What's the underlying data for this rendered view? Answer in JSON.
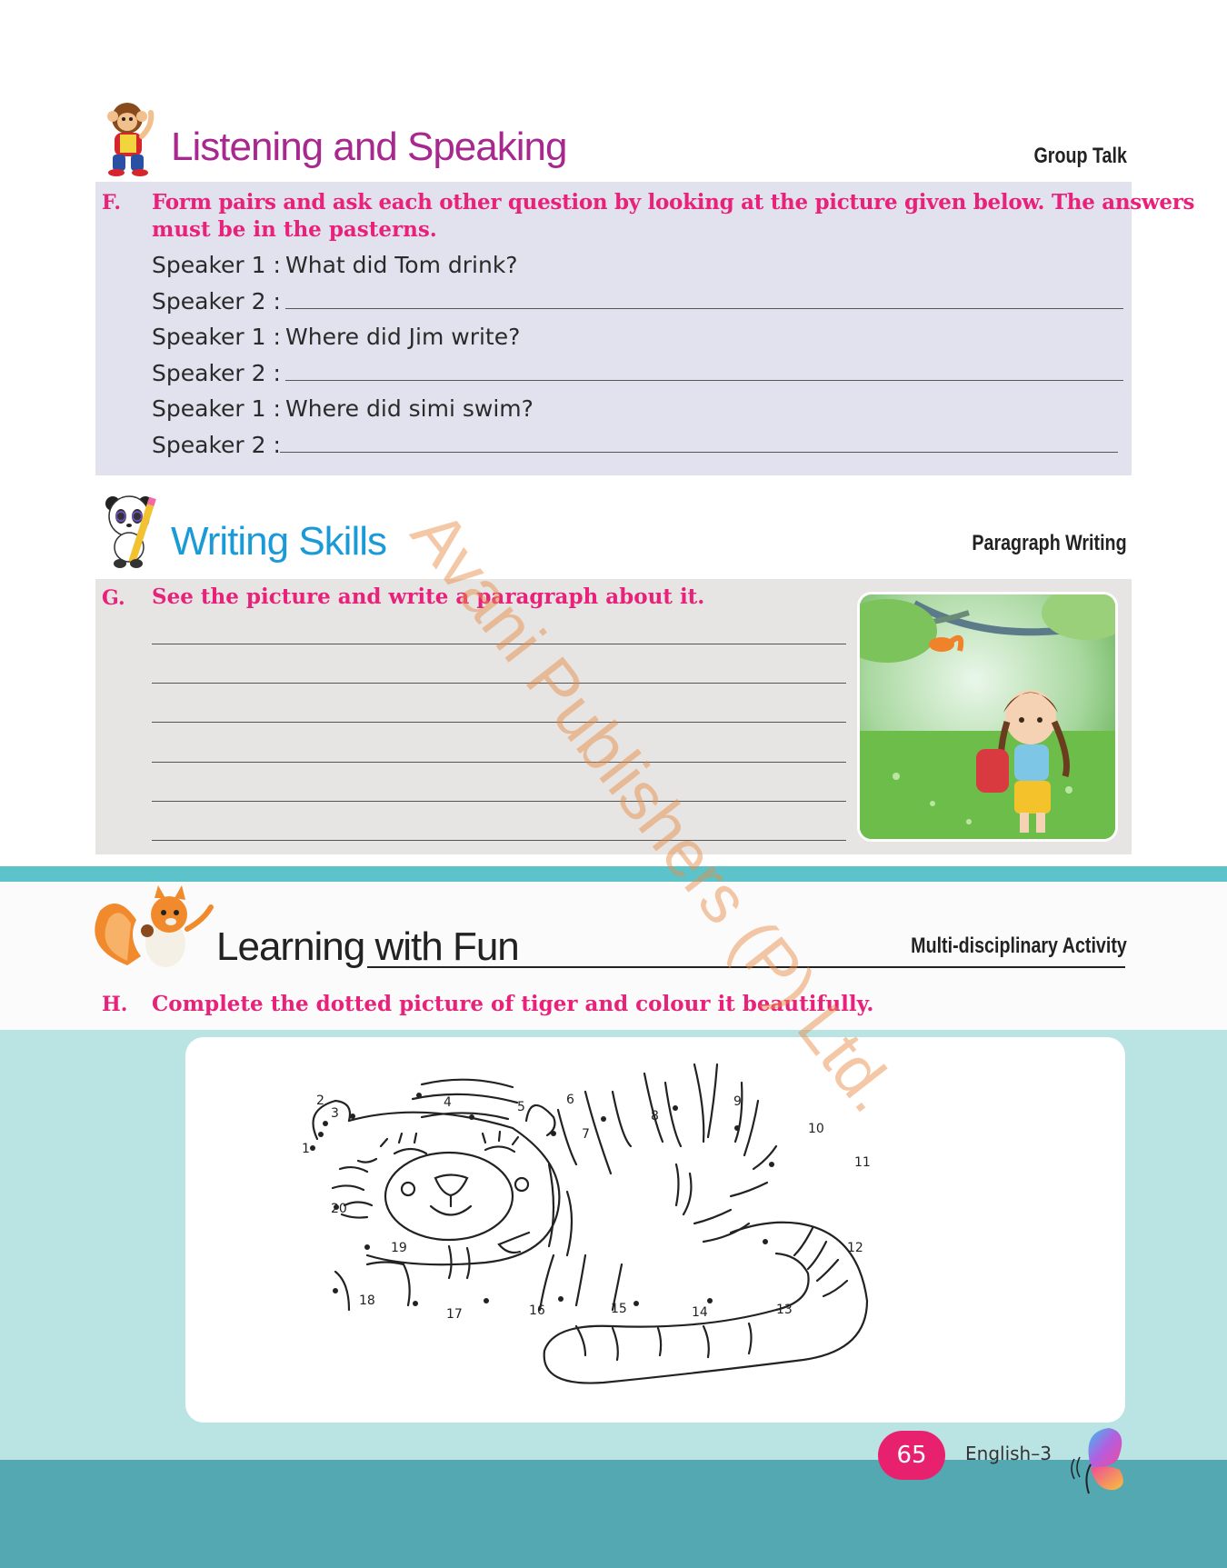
{
  "listening": {
    "title": "Listening and Speaking",
    "tag": "Group Talk",
    "letter": "F.",
    "instruction_line1": "Form pairs and ask each other question by looking at the picture given below. The answers",
    "instruction_line2": "must be in the pasterns.",
    "dialogue": [
      {
        "label": "Speaker 1 :",
        "text": "What did Tom drink?"
      },
      {
        "label": "Speaker 2 :",
        "text": ""
      },
      {
        "label": "Speaker 1 :",
        "text": "Where did Jim write?"
      },
      {
        "label": "Speaker 2 :",
        "text": ""
      },
      {
        "label": "Speaker 1 :",
        "text": "Where did simi swim?"
      },
      {
        "label": "Speaker 2 :",
        "text": ""
      }
    ]
  },
  "writing": {
    "title": "Writing Skills",
    "tag": "Paragraph Writing",
    "letter": "G.",
    "instruction": "See the picture and write a paragraph about it."
  },
  "fun": {
    "title": "Learning with Fun",
    "tag": "Multi-disciplinary Activity",
    "letter": "H.",
    "instruction": "Complete the dotted picture of tiger and colour it beautifully.",
    "dot_numbers": [
      "1",
      "2",
      "3",
      "4",
      "5",
      "6",
      "7",
      "8",
      "9",
      "10",
      "11",
      "12",
      "13",
      "14",
      "15",
      "16",
      "17",
      "18",
      "19",
      "20"
    ]
  },
  "watermark": "Avani Publishers (P) Ltd.",
  "footer": {
    "page_number": "65",
    "book": "English–3"
  },
  "colors": {
    "listening_title": "#a7288f",
    "writing_title": "#1a9ad6",
    "instruction": "#e8217a",
    "panel_f": "#e2e2ef",
    "panel_g": "#e7e5e3",
    "teal": "#5cc3cb",
    "mint": "#bae3e4",
    "dark_teal": "#53a8b1",
    "page_badge": "#e8216f"
  },
  "icons": [
    "monkey-mascot-icon",
    "panda-mascot-icon",
    "squirrel-mascot-icon",
    "butterfly-icon"
  ]
}
